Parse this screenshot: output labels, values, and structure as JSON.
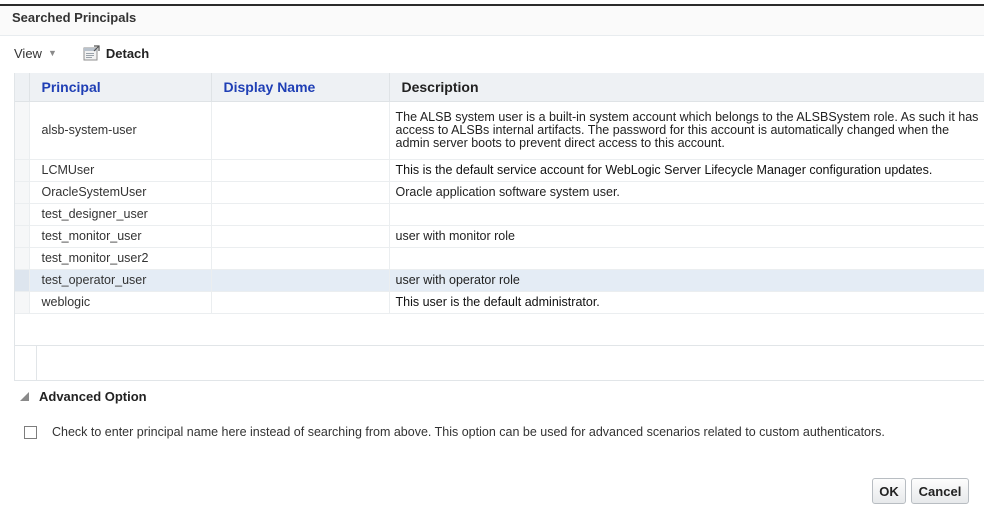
{
  "section": {
    "title": "Searched Principals"
  },
  "toolbar": {
    "view_label": "View",
    "detach_label": "Detach"
  },
  "table": {
    "headers": {
      "principal": "Principal",
      "display_name": "Display Name",
      "description": "Description"
    },
    "rows": [
      {
        "principal": "alsb-system-user",
        "display_name": "",
        "description": "The ALSB system user is a built-in system account which belongs to the ALSBSystem role. As such it has access to ALSBs internal artifacts. The password for this account is automatically changed when the admin server boots to prevent direct access to this account."
      },
      {
        "principal": "LCMUser",
        "display_name": "",
        "description": "This is the default service account for WebLogic Server Lifecycle Manager configuration updates."
      },
      {
        "principal": "OracleSystemUser",
        "display_name": "",
        "description": "Oracle application software system user."
      },
      {
        "principal": "test_designer_user",
        "display_name": "",
        "description": ""
      },
      {
        "principal": "test_monitor_user",
        "display_name": "",
        "description": "user with monitor role"
      },
      {
        "principal": "test_monitor_user2",
        "display_name": "",
        "description": ""
      },
      {
        "principal": "test_operator_user",
        "display_name": "",
        "description": "user with operator role"
      },
      {
        "principal": "weblogic",
        "display_name": "",
        "description": "This user is the default administrator."
      }
    ],
    "selected_row": "test_operator_user"
  },
  "advanced": {
    "title": "Advanced Option",
    "checkbox_label": "Check to enter principal name here instead of searching from above. This option can be used for advanced scenarios related to custom authenticators.",
    "checked": false
  },
  "buttons": {
    "ok": "OK",
    "cancel": "Cancel"
  },
  "icons": {
    "view_menu": "dropdown-arrow-icon",
    "detach": "detach-icon",
    "advanced_toggle": "collapse-triangle-icon"
  },
  "colors": {
    "header_link": "#1f3fb5",
    "selected_row": "#e4ecf5",
    "header_bg": "#eef1f4"
  }
}
